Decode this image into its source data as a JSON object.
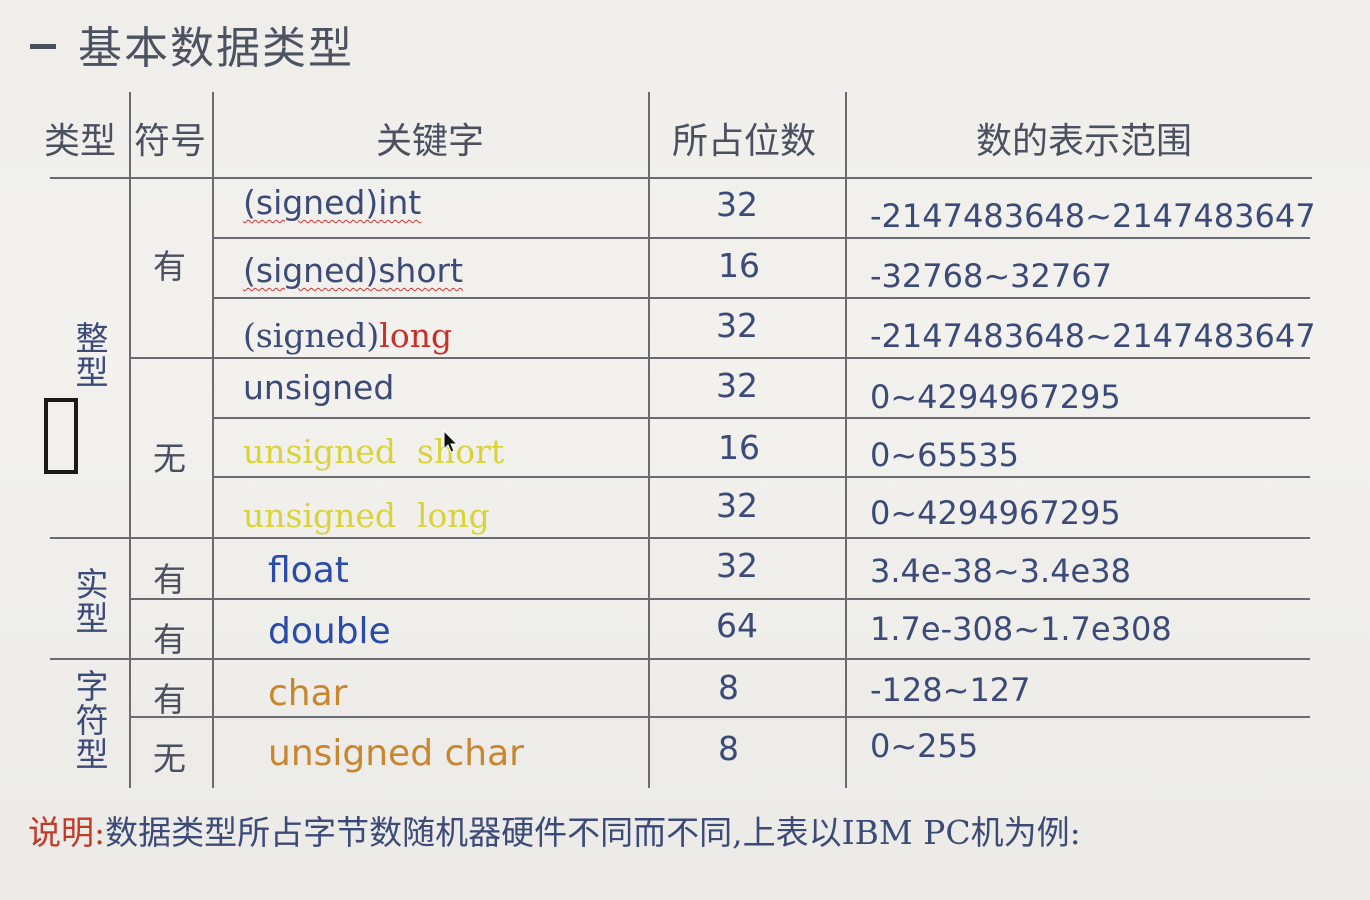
{
  "title": "基本数据类型",
  "colors": {
    "dark": "#3c4a78",
    "red": "#c8302a",
    "yellow": "#d8d438",
    "blue": "#2a4ca8",
    "orange": "#c8862e",
    "note_lead": "#c23a2a"
  },
  "headers": {
    "type": "类型",
    "sign": "符号",
    "keyword": "关键字",
    "bits": "所占位数",
    "range": "数的表示范围"
  },
  "categories": {
    "integer": "整型",
    "real": "实型",
    "char": "字符型"
  },
  "signs": {
    "int_signed": "有",
    "int_unsigned": "无",
    "float": "有",
    "double": "有",
    "char": "有",
    "uchar": "无"
  },
  "rows": [
    {
      "keyword": "(signed)int",
      "bits": "32",
      "range": "-2147483648~2147483647"
    },
    {
      "keyword_prefix": "(signed)",
      "keyword_suffix": "short",
      "bits": "16",
      "range": "-32768~32767"
    },
    {
      "keyword_prefix": "(signed)",
      "keyword_suffix": "long",
      "bits": "32",
      "range": "-2147483648~2147483647"
    },
    {
      "keyword": "unsigned",
      "bits": "32",
      "range": "0~4294967295"
    },
    {
      "keyword": "unsigned  short",
      "bits": "16",
      "range": "0~65535"
    },
    {
      "keyword": "unsigned  long",
      "bits": "32",
      "range": "0~4294967295"
    },
    {
      "keyword": "float",
      "bits": "32",
      "range": "3.4e-38~3.4e38"
    },
    {
      "keyword": "double",
      "bits": "64",
      "range": "1.7e-308~1.7e308"
    },
    {
      "keyword": "char",
      "bits": "8",
      "range": "-128~127"
    },
    {
      "keyword": "unsigned char",
      "bits": "8",
      "range": "0~255"
    }
  ],
  "note": {
    "lead": "说明:",
    "text": "数据类型所占字节数随机器硬件不同而不同,上表以IBM PC机为例:"
  }
}
